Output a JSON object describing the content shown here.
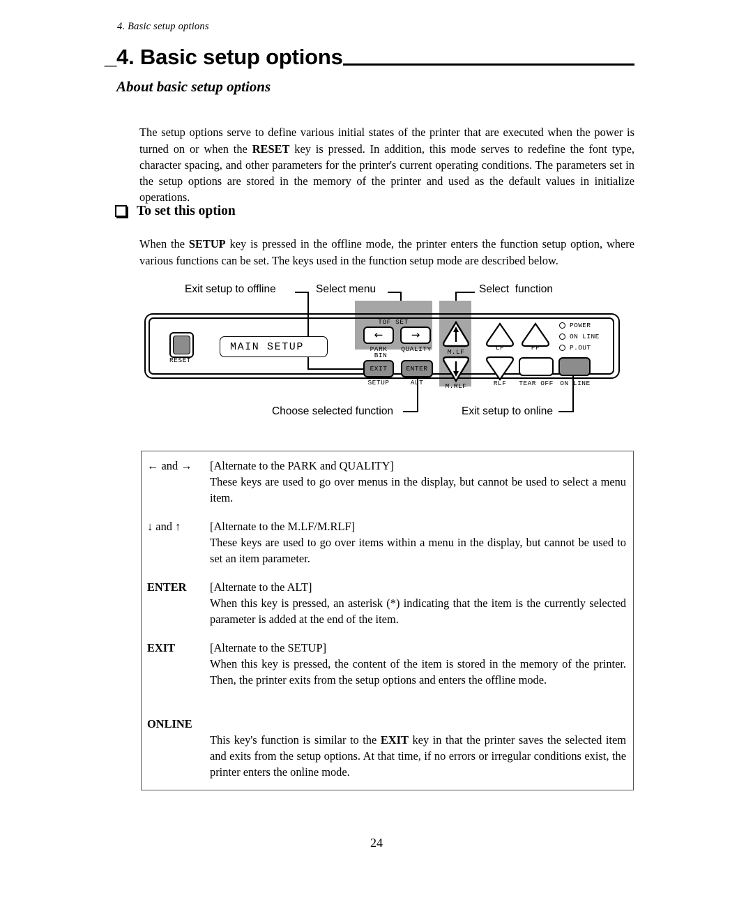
{
  "running_head": "4.  Basic setup options",
  "chapter_title": "_4. Basic setup options",
  "section_heading": "About basic setup options",
  "intro_paragraph": "The setup options serve to define various initial states of the printer that are executed when the power is turned on or when the RESET key is pressed.  In addition, this mode serves to redefine the font type, character spacing, and other parameters for the printer's current operating conditions.  The parameters set in the setup options are stored in the memory of the printer and used as the default values in initialize operations.",
  "intro_paragraph_parts": {
    "before": "The setup options serve to define various initial states of the printer that are executed when the power is turned on or when the ",
    "bold": "RESET",
    "after": " key is pressed.  In addition, this mode serves to redefine the font type, character spacing, and other parameters for the printer's current operating conditions.  The parameters set in the setup options are stored in the memory of the printer and used as the default values in initialize operations."
  },
  "subhead": "To set this option",
  "setup_paragraph_parts": {
    "before": "When the ",
    "bold": "SETUP",
    "after": " key is pressed in the offline mode, the printer enters the function setup option, where various functions can be set.  The keys used in the function setup mode are described below."
  },
  "figure": {
    "callouts": {
      "exit_offline": "Exit setup to offline",
      "select_menu": "Select menu",
      "select_function": "Select  function",
      "choose_function": "Choose selected function",
      "exit_online": "Exit setup to online"
    },
    "panel": {
      "reset_label": "RESET",
      "display_text": "MAIN SETUP",
      "keys": {
        "tof_set": "TOF SET",
        "left_arrow": "←",
        "right_arrow": "→",
        "park": "PARK",
        "quality": "QUALITY",
        "bin": "BIN",
        "exit": "EXIT",
        "setup": "SETUP",
        "enter": "ENTER",
        "alt": "ALT",
        "m_lf": "M.LF",
        "m_rlf": "M.RLF",
        "up_arrow": "↑",
        "down_arrow": "↓",
        "lf": "LF",
        "ff": "FF",
        "rlf": "RLF",
        "tear_off": "TEAR OFF",
        "on_line": "ON LINE"
      },
      "leds": [
        {
          "label": "POWER"
        },
        {
          "label": "ON LINE"
        },
        {
          "label": "P.OUT"
        }
      ]
    },
    "band_color": "#a6a6a6",
    "key_gray": "#8c8c8c"
  },
  "key_table": [
    {
      "name": "← and →",
      "bold_name": false,
      "alternate": "[Alternate to the PARK and QUALITY]",
      "description": "These keys are used to go over menus in the display, but cannot be used to select a menu item."
    },
    {
      "name": "↓ and ↑",
      "bold_name": false,
      "alternate": " [Alternate to the M.LF/M.RLF]",
      "description": "These keys are used to go over items within a menu in the display, but cannot be used to set an item parameter."
    },
    {
      "name": "ENTER",
      "bold_name": true,
      "alternate": "[Alternate to the ALT]",
      "description": "When this key is pressed, an asterisk (*) indicating that the item is the currently selected parameter is added at the end of the item."
    },
    {
      "name": "EXIT",
      "bold_name": true,
      "alternate": "[Alternate to the SETUP]",
      "description": "When this key is pressed, the content of the item is stored in the memory of the printer.  Then, the printer exits from the setup options and enters the offline mode."
    },
    {
      "name": "ONLINE",
      "bold_name": true,
      "alternate": "",
      "description_parts": {
        "before": "This key's function is similar to the ",
        "bold": "EXIT",
        "after": " key in that the printer saves the selected item and exits from the setup options.  At that time, if no errors or irregular conditions exist, the printer enters the online mode."
      },
      "description": "This key's function is similar to the EXIT key in that the printer saves the selected item and exits from the setup options.  At that time, if no errors or irregular conditions exist, the printer enters the online mode."
    }
  ],
  "page_number": "24"
}
